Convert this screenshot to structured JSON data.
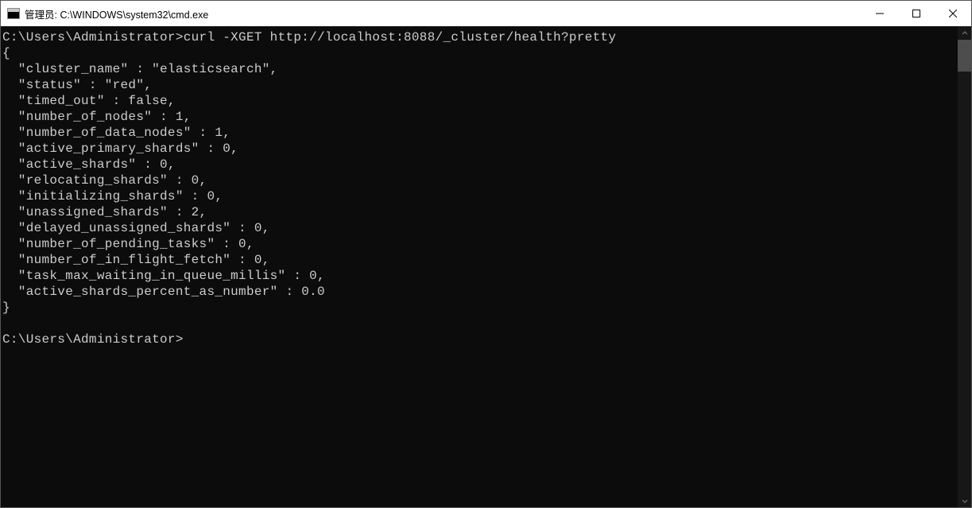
{
  "window": {
    "title": "管理员: C:\\WINDOWS\\system32\\cmd.exe"
  },
  "terminal": {
    "prompt1_path": "C:\\Users\\Administrator>",
    "command": "curl -XGET http://localhost:8088/_cluster/health?pretty",
    "json_output": {
      "open_brace": "{",
      "lines": [
        "  \"cluster_name\" : \"elasticsearch\",",
        "  \"status\" : \"red\",",
        "  \"timed_out\" : false,",
        "  \"number_of_nodes\" : 1,",
        "  \"number_of_data_nodes\" : 1,",
        "  \"active_primary_shards\" : 0,",
        "  \"active_shards\" : 0,",
        "  \"relocating_shards\" : 0,",
        "  \"initializing_shards\" : 0,",
        "  \"unassigned_shards\" : 2,",
        "  \"delayed_unassigned_shards\" : 0,",
        "  \"number_of_pending_tasks\" : 0,",
        "  \"number_of_in_flight_fetch\" : 0,",
        "  \"task_max_waiting_in_queue_millis\" : 0,",
        "  \"active_shards_percent_as_number\" : 0.0"
      ],
      "close_brace": "}"
    },
    "prompt2_path": "C:\\Users\\Administrator>"
  }
}
